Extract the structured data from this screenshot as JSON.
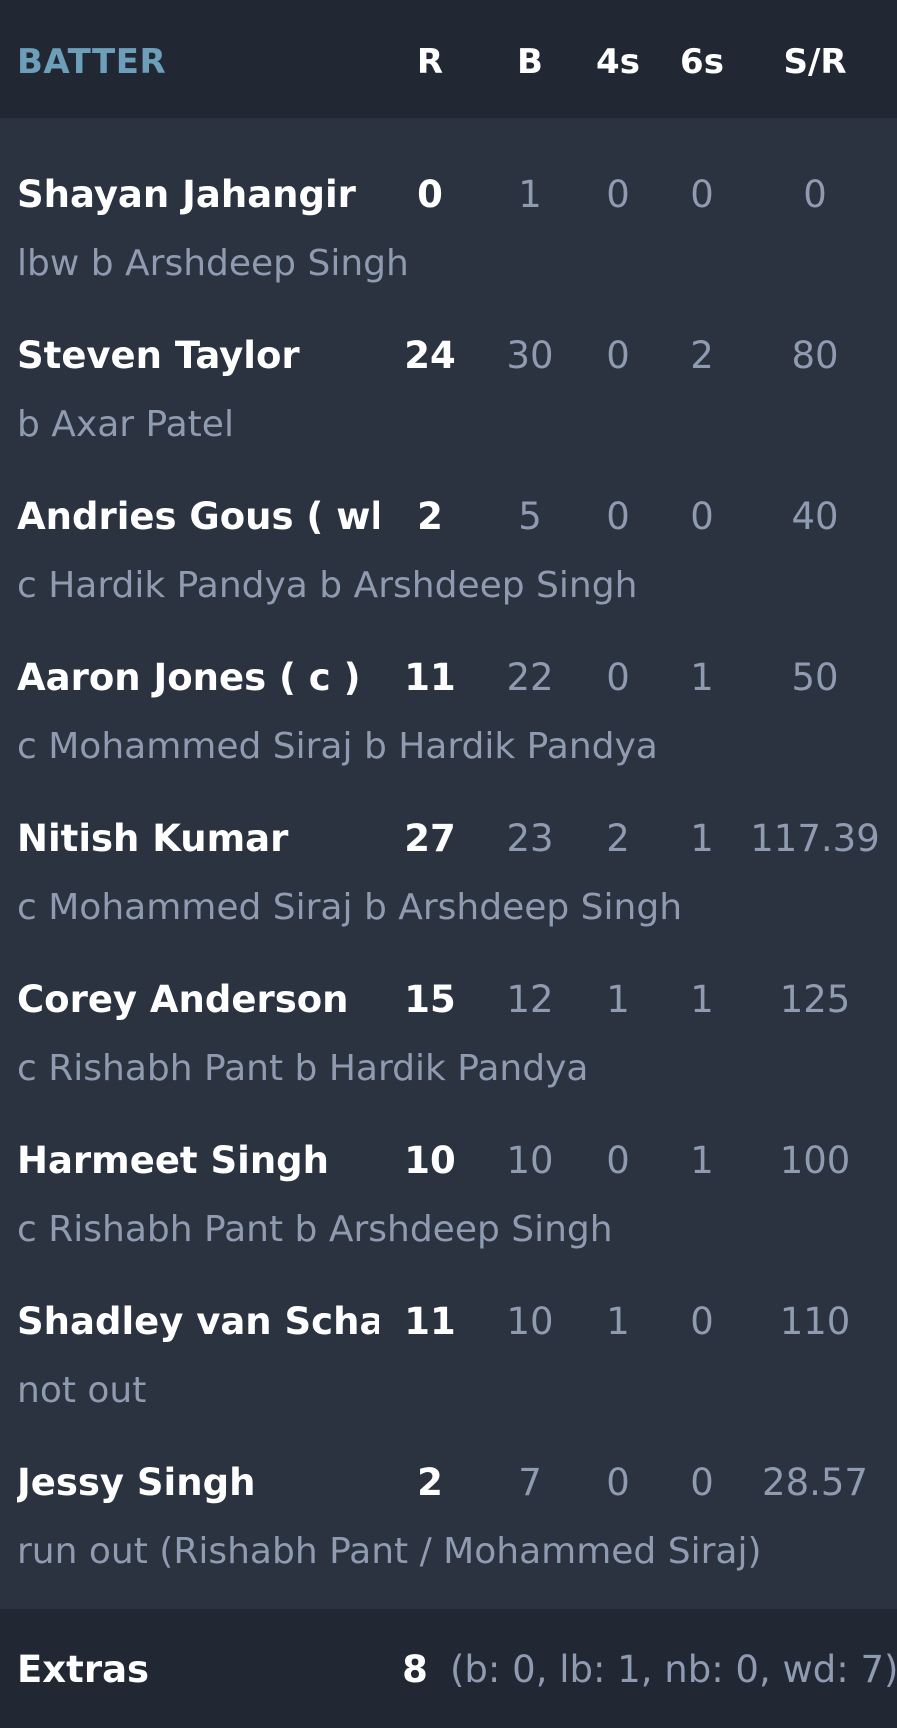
{
  "header": {
    "batter": "BATTER",
    "runs": "R",
    "balls": "B",
    "fours": "4s",
    "sixes": "6s",
    "strike_rate": "S/R"
  },
  "batters": [
    {
      "name": "Shayan Jahangir",
      "dismissal": "lbw b Arshdeep Singh",
      "r": "0",
      "b": "1",
      "fours": "0",
      "sixes": "0",
      "sr": "0"
    },
    {
      "name": "Steven Taylor",
      "dismissal": "b Axar Patel",
      "r": "24",
      "b": "30",
      "fours": "0",
      "sixes": "2",
      "sr": "80"
    },
    {
      "name": "Andries Gous ( wk )",
      "dismissal": "c Hardik Pandya b Arshdeep Singh",
      "r": "2",
      "b": "5",
      "fours": "0",
      "sixes": "0",
      "sr": "40"
    },
    {
      "name": "Aaron Jones ( c )",
      "dismissal": "c Mohammed Siraj b Hardik Pandya",
      "r": "11",
      "b": "22",
      "fours": "0",
      "sixes": "1",
      "sr": "50"
    },
    {
      "name": "Nitish Kumar",
      "dismissal": "c Mohammed Siraj b Arshdeep Singh",
      "r": "27",
      "b": "23",
      "fours": "2",
      "sixes": "1",
      "sr": "117.39"
    },
    {
      "name": "Corey Anderson",
      "dismissal": "c Rishabh Pant b Hardik Pandya",
      "r": "15",
      "b": "12",
      "fours": "1",
      "sixes": "1",
      "sr": "125"
    },
    {
      "name": "Harmeet Singh",
      "dismissal": "c Rishabh Pant b Arshdeep Singh",
      "r": "10",
      "b": "10",
      "fours": "0",
      "sixes": "1",
      "sr": "100"
    },
    {
      "name": "Shadley van Scha...",
      "dismissal": "not out",
      "r": "11",
      "b": "10",
      "fours": "1",
      "sixes": "0",
      "sr": "110"
    },
    {
      "name": "Jessy Singh",
      "dismissal": "run out (Rishabh Pant / Mohammed Siraj)",
      "r": "2",
      "b": "7",
      "fours": "0",
      "sixes": "0",
      "sr": "28.57"
    }
  ],
  "extras": {
    "label": "Extras",
    "total": "8",
    "detail": "(b: 0, lb: 1, nb: 0, wd: 7)"
  },
  "colors": {
    "background": "#2b3240",
    "header_background": "#212834",
    "batter_header": "#6e9fba",
    "dim_text": "#8f9bb0"
  }
}
